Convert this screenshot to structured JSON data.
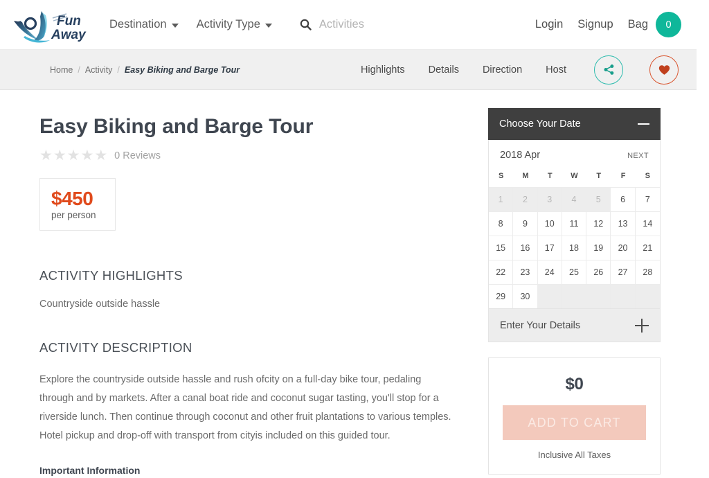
{
  "header": {
    "logo_alt": "Fun Away",
    "logo_line1": "Fun",
    "logo_line2": "Away",
    "nav": [
      {
        "label": "Destination",
        "has_caret": true
      },
      {
        "label": "Activity Type",
        "has_caret": true
      }
    ],
    "search": {
      "placeholder": "Activities",
      "value": ""
    },
    "login_label": "Login",
    "signup_label": "Signup",
    "bag_label": "Bag",
    "bag_count": "0",
    "bag_badge_color": "#0fb79a"
  },
  "subbar": {
    "breadcrumb": [
      {
        "label": "Home",
        "current": false
      },
      {
        "label": "Activity",
        "current": false
      },
      {
        "label": "Easy Biking and Barge Tour",
        "current": true
      }
    ],
    "separator": "/",
    "links": [
      "Highlights",
      "Details",
      "Direction",
      "Host"
    ],
    "share_icon": "share-icon",
    "favorite_icon": "heart-icon",
    "share_color": "#2bbbad",
    "favorite_color": "#d9552f"
  },
  "activity": {
    "title": "Easy Biking and Barge Tour",
    "stars": 5,
    "stars_filled": 0,
    "reviews_text": "0 Reviews",
    "price_amount": "$450",
    "price_unit": "per person",
    "price_color": "#e04a1c",
    "highlights_heading": "ACTIVITY HIGHLIGHTS",
    "highlights": [
      "Countryside outside hassle"
    ],
    "description_heading": "ACTIVITY DESCRIPTION",
    "description": "Explore the countryside outside hassle and rush ofcity on a full-day bike tour, pedaling through and by markets. After a canal boat ride and coconut sugar tasting, you'll stop for a riverside lunch. Then continue through coconut and other fruit plantations to various temples. Hotel pickup and drop-off with transport from cityis included on this guided tour.",
    "important_info_heading": "Important Information"
  },
  "booking": {
    "date_widget_title": "Choose Your Date",
    "collapse_icon": "minus-icon",
    "calendar": {
      "month_label": "2018 Apr",
      "next_label": "NEXT",
      "day_headers": [
        "S",
        "M",
        "T",
        "W",
        "T",
        "F",
        "S"
      ],
      "leading_blanks": 0,
      "cells": [
        {
          "day": "1",
          "state": "disabled"
        },
        {
          "day": "2",
          "state": "disabled"
        },
        {
          "day": "3",
          "state": "disabled"
        },
        {
          "day": "4",
          "state": "disabled"
        },
        {
          "day": "5",
          "state": "disabled"
        },
        {
          "day": "6",
          "state": "available"
        },
        {
          "day": "7",
          "state": "available"
        },
        {
          "day": "8",
          "state": "available"
        },
        {
          "day": "9",
          "state": "available"
        },
        {
          "day": "10",
          "state": "available"
        },
        {
          "day": "11",
          "state": "available"
        },
        {
          "day": "12",
          "state": "available"
        },
        {
          "day": "13",
          "state": "available"
        },
        {
          "day": "14",
          "state": "available"
        },
        {
          "day": "15",
          "state": "available"
        },
        {
          "day": "16",
          "state": "available"
        },
        {
          "day": "17",
          "state": "available"
        },
        {
          "day": "18",
          "state": "available"
        },
        {
          "day": "19",
          "state": "available"
        },
        {
          "day": "20",
          "state": "available"
        },
        {
          "day": "21",
          "state": "available"
        },
        {
          "day": "22",
          "state": "available"
        },
        {
          "day": "23",
          "state": "available"
        },
        {
          "day": "24",
          "state": "available"
        },
        {
          "day": "25",
          "state": "available"
        },
        {
          "day": "26",
          "state": "available"
        },
        {
          "day": "27",
          "state": "available"
        },
        {
          "day": "28",
          "state": "available"
        },
        {
          "day": "29",
          "state": "available"
        },
        {
          "day": "30",
          "state": "available"
        },
        {
          "day": "",
          "state": "empty"
        },
        {
          "day": "",
          "state": "empty"
        },
        {
          "day": "",
          "state": "empty"
        },
        {
          "day": "",
          "state": "empty"
        },
        {
          "day": "",
          "state": "empty"
        }
      ]
    },
    "details_row_label": "Enter Your Details",
    "details_expand_icon": "plus-icon",
    "cart_total": "$0",
    "add_to_cart_label": "ADD TO CART",
    "add_to_cart_disabled": true,
    "tax_note": "Inclusive All Taxes"
  }
}
